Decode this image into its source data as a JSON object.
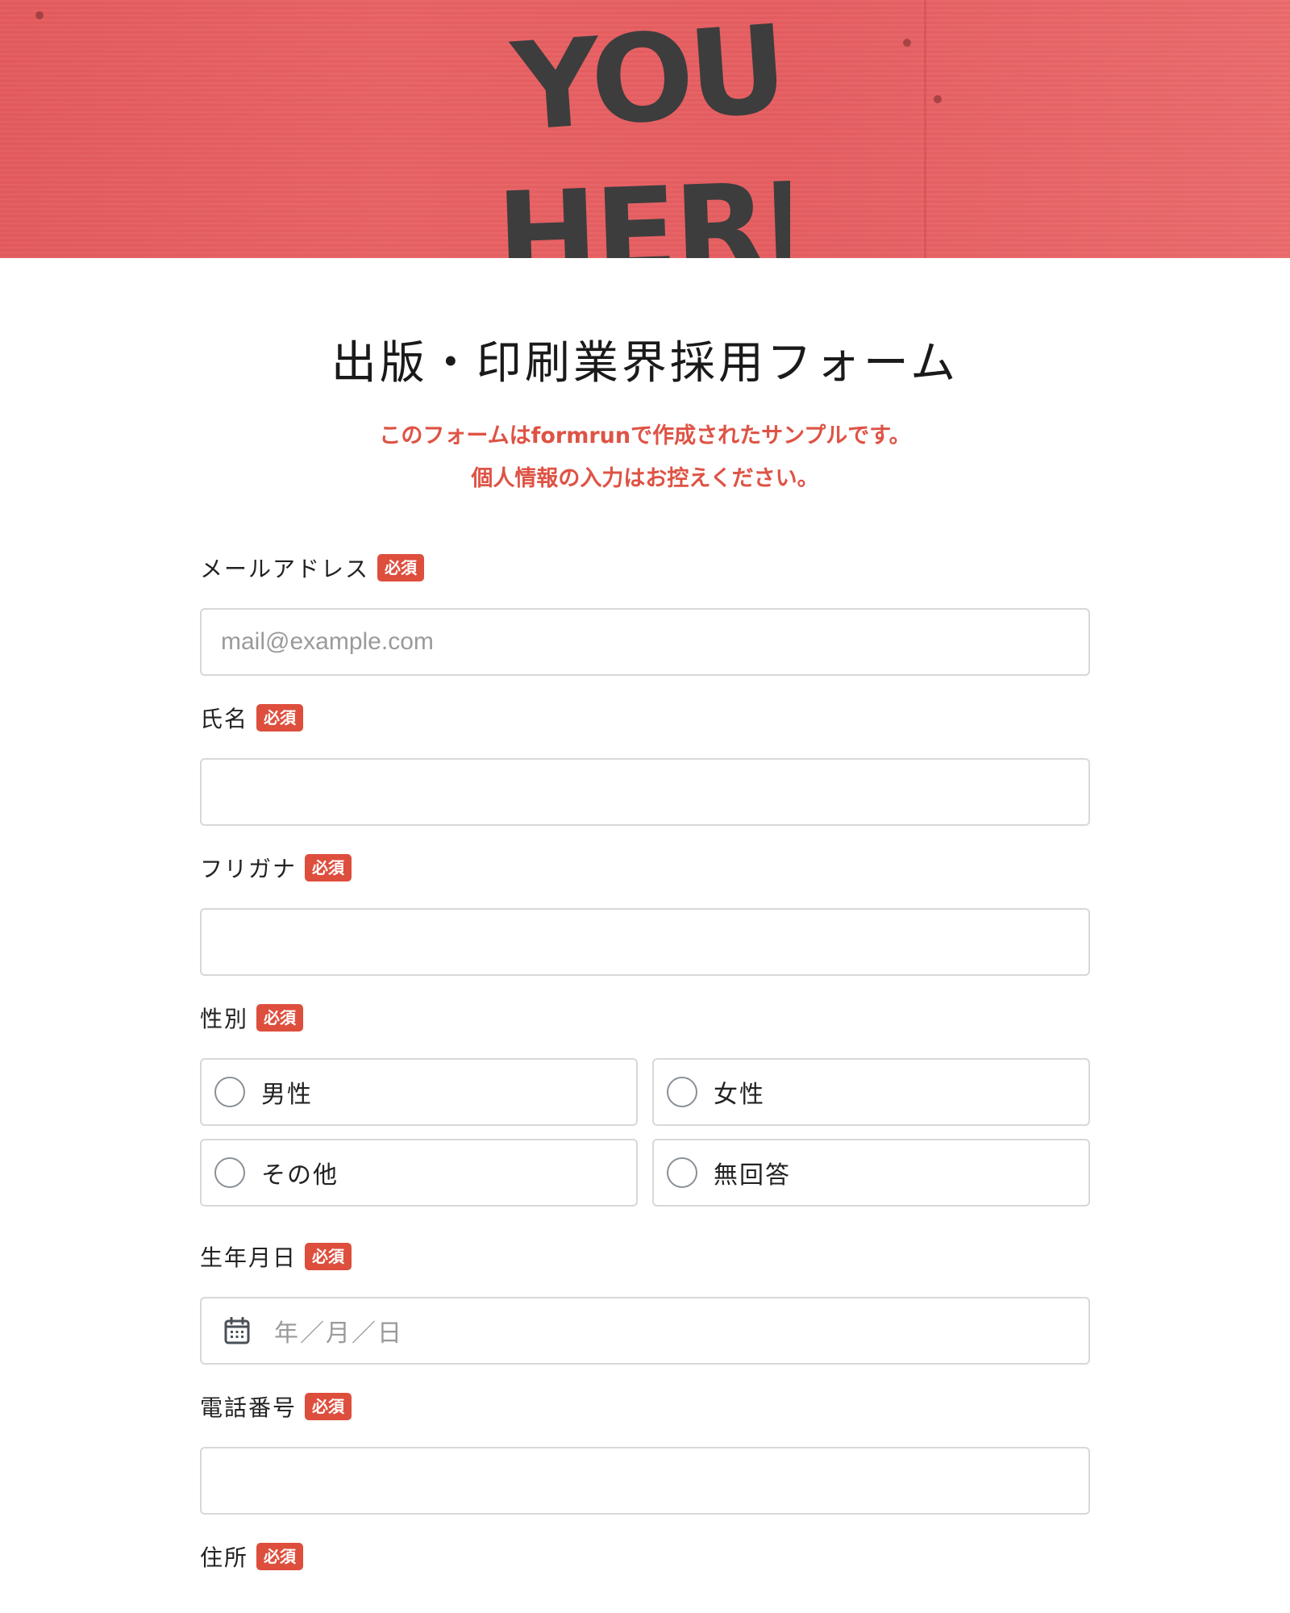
{
  "hero": {
    "text_line1": "YOU",
    "text_line2": "HERE",
    "bg_color": "#e55d60",
    "text_color": "#3d3d3d"
  },
  "form": {
    "title": "出版・印刷業界採用フォーム",
    "notice_line1": "このフォームはformrunで作成されたサンプルです。",
    "notice_line2": "個人情報の入力はお控えください。",
    "required_badge": "必須",
    "fields": {
      "email": {
        "label": "メールアドレス",
        "placeholder": "mail@example.com",
        "value": ""
      },
      "name": {
        "label": "氏名",
        "value": ""
      },
      "furigana": {
        "label": "フリガナ",
        "value": ""
      },
      "gender": {
        "label": "性別",
        "options": [
          "男性",
          "女性",
          "その他",
          "無回答"
        ],
        "selected": null
      },
      "birthdate": {
        "label": "生年月日",
        "placeholder": "年／月／日",
        "icon": "calendar-icon"
      },
      "phone": {
        "label": "電話番号",
        "value": ""
      },
      "address": {
        "label": "住所"
      }
    }
  },
  "colors": {
    "accent": "#de4e3d",
    "notice": "#de5345",
    "border": "#d8d8d8"
  }
}
